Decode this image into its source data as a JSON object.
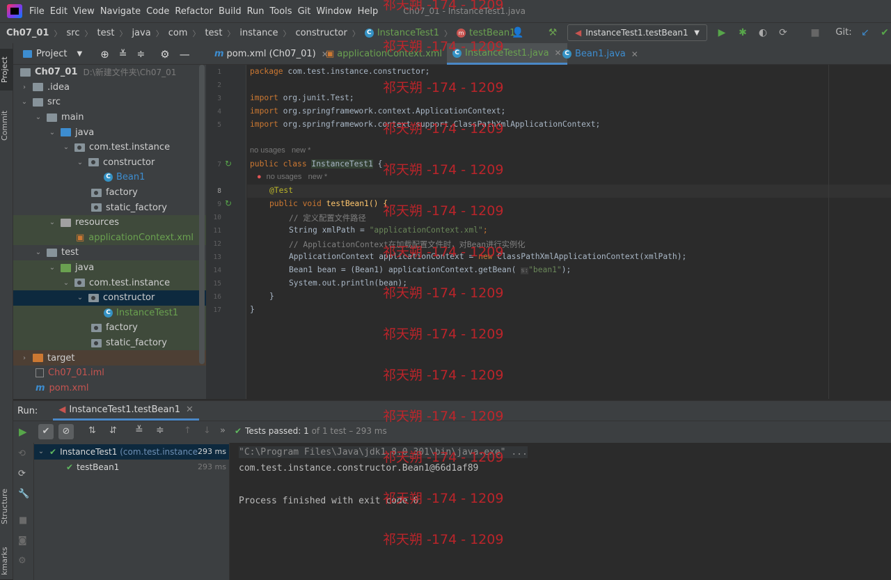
{
  "menubar": {
    "items": [
      "File",
      "Edit",
      "View",
      "Navigate",
      "Code",
      "Refactor",
      "Build",
      "Run",
      "Tools",
      "Git",
      "Window",
      "Help"
    ],
    "window_title": "Ch07_01 - InstanceTest1.java"
  },
  "navbar": {
    "crumbs": [
      "Ch07_01",
      "src",
      "test",
      "java",
      "com",
      "test",
      "instance",
      "constructor",
      "InstanceTest1",
      "testBean1"
    ],
    "run_config": "InstanceTest1.testBean1",
    "git_label": "Git:"
  },
  "left_strip": {
    "project": "Project",
    "commit": "Commit",
    "structure": "Structure",
    "bookmarks": "kmarks"
  },
  "project_panel": {
    "title": "Project",
    "tree": [
      {
        "label": "Ch07_01",
        "extra": "D:\\新建文件夹\\Ch07_01"
      },
      {
        "label": ".idea"
      },
      {
        "label": "src"
      },
      {
        "label": "main"
      },
      {
        "label": "java"
      },
      {
        "label": "com.test.instance"
      },
      {
        "label": "constructor"
      },
      {
        "label": "Bean1"
      },
      {
        "label": "factory"
      },
      {
        "label": "static_factory"
      },
      {
        "label": "resources"
      },
      {
        "label": "applicationContext.xml"
      },
      {
        "label": "test"
      },
      {
        "label": "java"
      },
      {
        "label": "com.test.instance"
      },
      {
        "label": "constructor"
      },
      {
        "label": "InstanceTest1"
      },
      {
        "label": "factory"
      },
      {
        "label": "static_factory"
      },
      {
        "label": "target"
      },
      {
        "label": "Ch07_01.iml"
      },
      {
        "label": "pom.xml"
      }
    ]
  },
  "editor_tabs": [
    "pom.xml (Ch07_01)",
    "applicationContext.xml",
    "InstanceTest1.java",
    "Bean1.java"
  ],
  "editor": {
    "line_numbers": [
      "1",
      "2",
      "3",
      "4",
      "5",
      "",
      "7",
      "",
      "8",
      "9",
      "10",
      "11",
      "12",
      "13",
      "14",
      "15",
      "16",
      "17"
    ],
    "hints": {
      "no_usages": "no usages",
      "new": "new *"
    },
    "lines": {
      "l1": "com.test.instance.constructor;",
      "l3": "org.junit.Test;",
      "l4": "org.springframework.context.ApplicationContext;",
      "l5": "org.springframework.context.support.ClassPathXmlApplicationContext;",
      "class_name": "InstanceTest1",
      "method": "testBean1() {",
      "c10": "// 定义配置文件路径",
      "l11a": "String xmlPath = ",
      "l11b": "\"applicationContext.xml\"",
      "c12": "// ApplicationContext在加载配置文件时，对Bean进行实例化",
      "l13a": "ApplicationContext applicationContext = ",
      "l13b": "ClassPathXmlApplicationContext(xmlPath);",
      "l14a": "Bean1 bean = (Bean1) applicationContext.getBean( ",
      "l14b": "s:",
      "l14c": "\"bean1\"",
      "l14d": ");",
      "l15": "System.out.println(bean);"
    }
  },
  "run_panel": {
    "label": "Run:",
    "tab": "InstanceTest1.testBean1",
    "status": "Tests passed:",
    "status_count": "1",
    "status_rest": "of 1 test – 293 ms",
    "tree": [
      {
        "label": "InstanceTest1",
        "pkg": "(com.test.instance",
        "time": "293 ms"
      },
      {
        "label": "testBean1",
        "time": "293 ms"
      }
    ],
    "console": [
      "\"C:\\Program Files\\Java\\jdk1.8.0_301\\bin\\java.exe\" ...",
      "com.test.instance.constructor.Bean1@66d1af89",
      "",
      "Process finished with exit code 0"
    ]
  },
  "watermark": "祁天朔 -174 - 1209"
}
